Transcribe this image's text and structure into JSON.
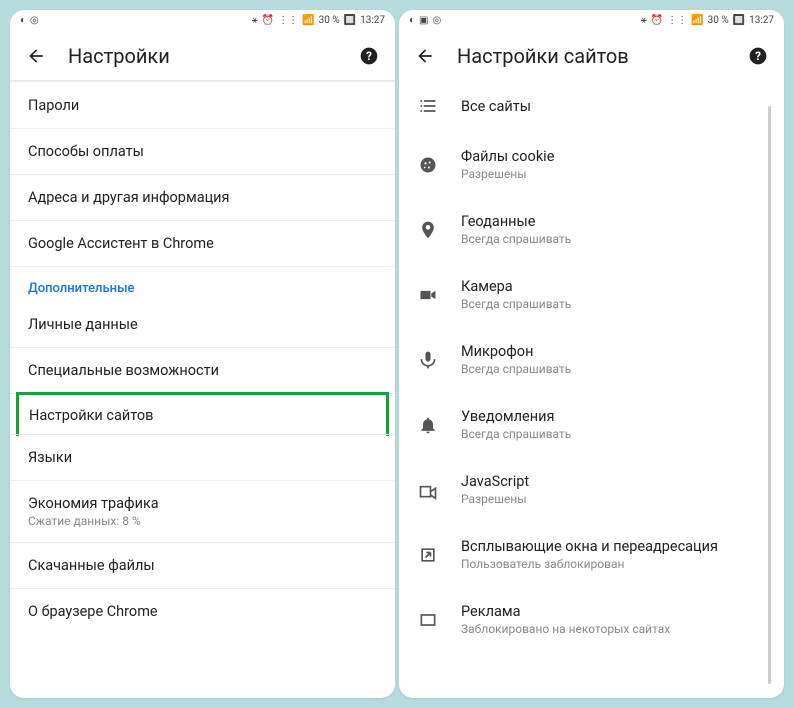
{
  "status": {
    "time": "13:27",
    "battery": "30 %"
  },
  "left": {
    "title": "Настройки",
    "rows": [
      {
        "label": "Пароли"
      },
      {
        "label": "Способы оплаты"
      },
      {
        "label": "Адреса и другая информация"
      },
      {
        "label": "Google Ассистент в Chrome"
      }
    ],
    "section": "Дополнительные",
    "rows2": [
      {
        "label": "Личные данные"
      },
      {
        "label": "Специальные возможности"
      },
      {
        "label": "Настройки сайтов",
        "highlight": true
      },
      {
        "label": "Языки"
      },
      {
        "label": "Экономия трафика",
        "sub": "Сжатие данных: 8 %"
      },
      {
        "label": "Скачанные файлы"
      },
      {
        "label": "О браузере Chrome"
      }
    ]
  },
  "right": {
    "title": "Настройки сайтов",
    "items": [
      {
        "icon": "list",
        "label": "Все сайты"
      },
      {
        "icon": "cookie",
        "label": "Файлы cookie",
        "sub": "Разрешены"
      },
      {
        "icon": "location",
        "label": "Геоданные",
        "sub": "Всегда спрашивать"
      },
      {
        "icon": "camera",
        "label": "Камера",
        "sub": "Всегда спрашивать"
      },
      {
        "icon": "mic",
        "label": "Микрофон",
        "sub": "Всегда спрашивать"
      },
      {
        "icon": "bell",
        "label": "Уведомления",
        "sub": "Всегда спрашивать"
      },
      {
        "icon": "js",
        "label": "JavaScript",
        "sub": "Разрешены"
      },
      {
        "icon": "popup",
        "label": "Всплывающие окна и переадресация",
        "sub": "Пользователь заблокирован"
      },
      {
        "icon": "ads",
        "label": "Реклама",
        "sub": "Заблокировано на некоторых сайтах"
      }
    ]
  }
}
